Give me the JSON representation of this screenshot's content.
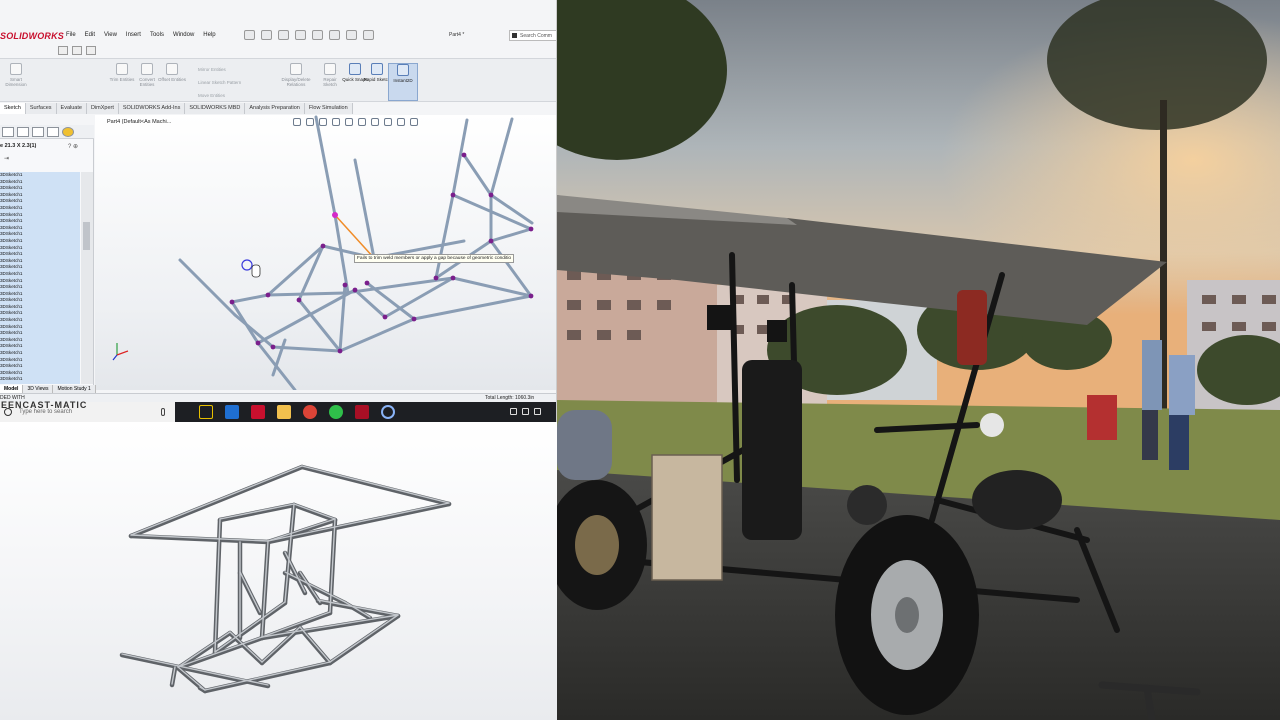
{
  "solidworks": {
    "logo": "SOLIDWORKS",
    "menu": [
      "File",
      "Edit",
      "View",
      "Insert",
      "Tools",
      "Window",
      "Help"
    ],
    "part_name": "Part4 *",
    "search_placeholder": "Search Comm",
    "ribbon": {
      "smart_dimension": "Smart Dimension",
      "trim_entities": "Trim Entities",
      "convert_entities": "Convert Entities",
      "offset_entities": "Offset Entities",
      "mirror_entities": "Mirror Entities",
      "linear_sketch_pattern": "Linear Sketch Pattern",
      "move_entities": "Move Entities",
      "display_delete_relations": "Display/Delete Relations",
      "repair_sketch": "Repair Sketch",
      "quick_snaps": "Quick Snaps",
      "rapid_sketch": "Rapid Sketch",
      "instant2d": "Instant2D"
    },
    "tabs": [
      "Sketch",
      "Surfaces",
      "Evaluate",
      "DimXpert",
      "SOLIDWORKS Add-Ins",
      "SOLIDWORKS MBD",
      "Analysis Preparation",
      "Flow Simulation"
    ],
    "active_tab": "Sketch",
    "property_title": "e 21.3 X 2.3(1)",
    "property_icons": "? ⊕",
    "pin": "⇥",
    "tree_items": [
      "3DSketch1",
      "3DSketch1",
      "3DSketch1",
      "3DSketch1",
      "3DSketch1",
      "3DSketch1",
      "3DSketch1",
      "3DSketch1",
      "3DSketch1",
      "3DSketch1",
      "3DSketch1",
      "3DSketch1",
      "3DSketch1",
      "3DSketch1",
      "3DSketch1",
      "3DSketch1",
      "3DSketch1",
      "3DSketch1",
      "3DSketch1",
      "3DSketch1",
      "3DSketch1",
      "3DSketch1",
      "3DSketch1",
      "3DSketch1",
      "3DSketch1",
      "3DSketch1",
      "3DSketch1",
      "3DSketch1",
      "3DSketch1",
      "3DSketch1",
      "3DSketch1",
      "3DSketch1"
    ],
    "view_title": "Part4 (Default<As Machi...",
    "tooltip": "Fails to trim weld members or apply a gap because of geometric conditio",
    "bottom_tabs": [
      "Model",
      "3D Views",
      "Motion Study 1"
    ],
    "status_left": "DED WITH",
    "total_length": "Total Length: 1060.3in"
  },
  "taskbar": {
    "search_text": "Type here to search",
    "watermark_brand": "EENCAST-MATIC"
  },
  "colors": {
    "tube": "#8a9db4",
    "node": "#7a1f8c",
    "selected_node": "#d428c8",
    "orange_link": "#f08c28",
    "sw_red": "#c8102e"
  }
}
